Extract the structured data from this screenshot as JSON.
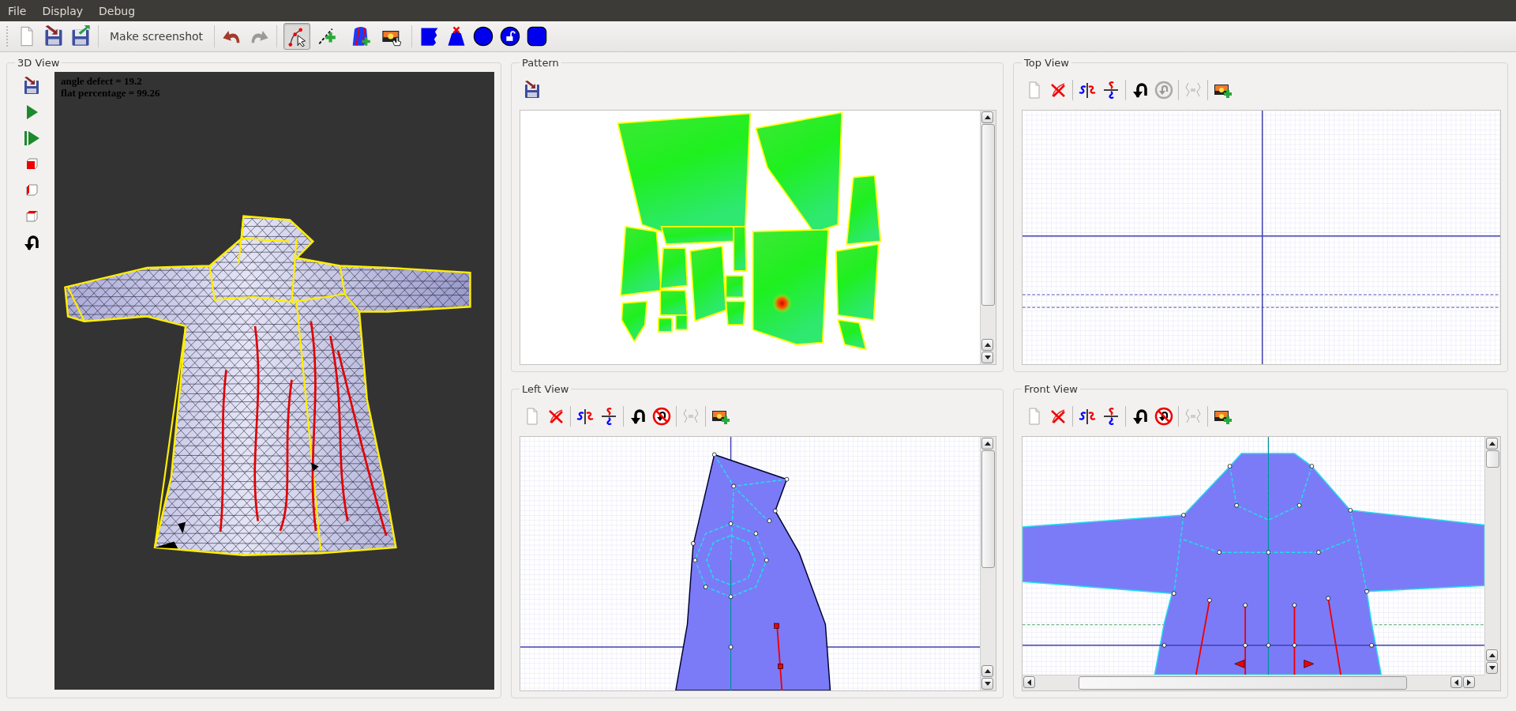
{
  "menu": [
    {
      "label": "File"
    },
    {
      "label": "Display"
    },
    {
      "label": "Debug"
    }
  ],
  "toolbar": {
    "screenshot_label": "Make screenshot",
    "redo": {
      "disabled": true
    },
    "tools": [
      {
        "selected": true
      },
      {
        "selected": false
      },
      {
        "selected": false
      },
      {
        "selected": false
      }
    ]
  },
  "view_3d": {
    "title": "3D View",
    "overlay_lines": [
      "angle defect = 19.2",
      "flat percentage = 99.26"
    ]
  },
  "pattern": {
    "title": "Pattern"
  },
  "views": [
    {
      "title": "Top View",
      "redo": {
        "disabled": true
      }
    },
    {
      "title": "Left View",
      "redo": {
        "disabled": false
      }
    },
    {
      "title": "Front View",
      "redo": {
        "disabled": false
      }
    }
  ]
}
